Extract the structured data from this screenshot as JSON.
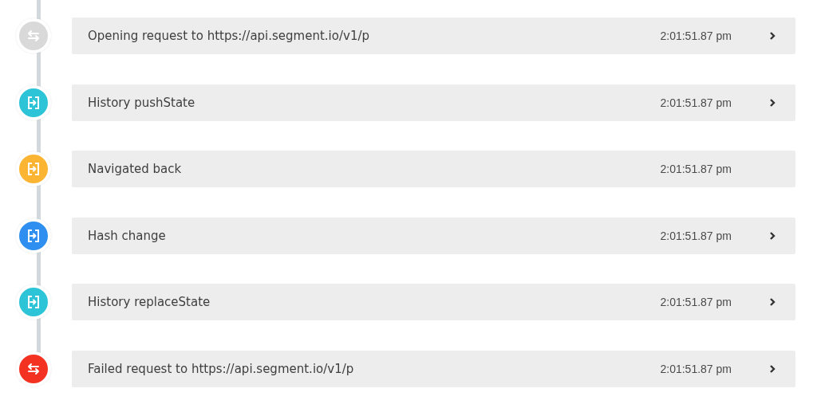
{
  "events": [
    {
      "kind": "request",
      "color": "#d9d9d9",
      "text": "Opening request to https://api.segment.io/v1/p",
      "time": "2:01:51.87 pm",
      "expandable": true
    },
    {
      "kind": "navigation",
      "color": "#2cc4d6",
      "text": "History pushState",
      "time": "2:01:51.87 pm",
      "expandable": true
    },
    {
      "kind": "navigation",
      "color": "#fbb532",
      "text": "Navigated back",
      "time": "2:01:51.87 pm",
      "expandable": false
    },
    {
      "kind": "navigation",
      "color": "#2e8ff0",
      "text": "Hash change",
      "time": "2:01:51.87 pm",
      "expandable": true
    },
    {
      "kind": "navigation",
      "color": "#2cc4d6",
      "text": "History replaceState",
      "time": "2:01:51.87 pm",
      "expandable": true
    },
    {
      "kind": "request",
      "color": "#f33221",
      "text": "Failed request to https://api.segment.io/v1/p",
      "time": "2:01:51.87 pm",
      "expandable": true
    }
  ]
}
